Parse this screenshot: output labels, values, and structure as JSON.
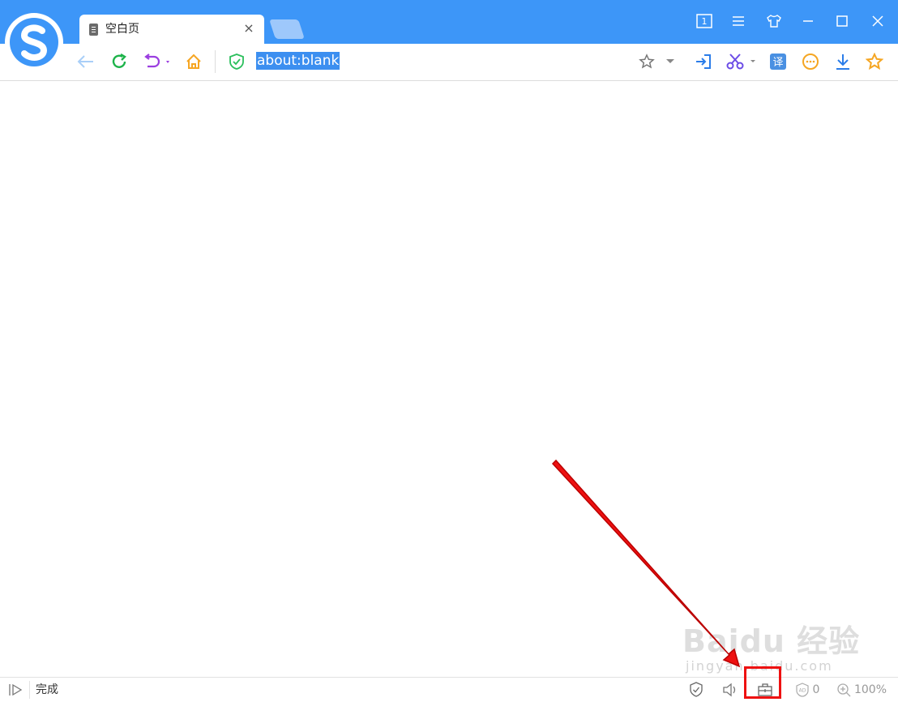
{
  "tab": {
    "title": "空白页",
    "close": "×"
  },
  "address_bar": {
    "url": "about:blank"
  },
  "window_controls": {
    "tab_count": "1"
  },
  "status": {
    "text": "完成",
    "adblock_count": "0",
    "zoom": "100%"
  },
  "watermark": {
    "line1": "Baidu 经验",
    "line2": "jingyan.baidu.com"
  },
  "colors": {
    "titlebar": "#3d96f8",
    "selection": "#3c8ff0",
    "highlight": "#e11111"
  }
}
